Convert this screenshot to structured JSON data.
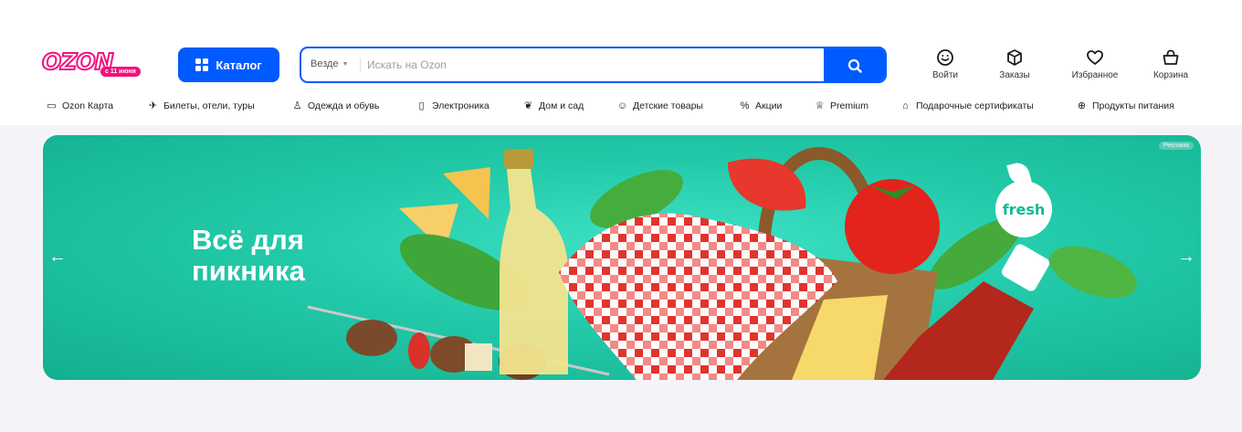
{
  "logo": {
    "text": "OZON",
    "badge": "с 11 июня"
  },
  "catalog_button": {
    "label": "Каталог"
  },
  "search": {
    "scope": "Везде",
    "placeholder": "Искать на Ozon"
  },
  "actions": [
    {
      "label": "Войти",
      "icon": "smile-icon"
    },
    {
      "label": "Заказы",
      "icon": "box-icon"
    },
    {
      "label": "Избранное",
      "icon": "heart-icon"
    },
    {
      "label": "Корзина",
      "icon": "basket-icon"
    }
  ],
  "nav": [
    {
      "label": "Ozon Карта",
      "icon": "card-icon"
    },
    {
      "label": "Билеты, отели, туры",
      "icon": "plane-icon"
    },
    {
      "label": "Одежда и обувь",
      "icon": "clothes-icon"
    },
    {
      "label": "Электроника",
      "icon": "phone-icon"
    },
    {
      "label": "Дом и сад",
      "icon": "plant-icon"
    },
    {
      "label": "Детские товары",
      "icon": "baby-icon"
    },
    {
      "label": "Акции",
      "icon": "percent-icon"
    },
    {
      "label": "Premium",
      "icon": "crown-icon"
    },
    {
      "label": "Подарочные сертификаты",
      "icon": "gift-icon"
    },
    {
      "label": "Продукты питания",
      "icon": "food-icon"
    }
  ],
  "banner": {
    "title_line1": "Всё для",
    "title_line2": "пикника",
    "ad_label": "Реклама",
    "brand_badge": "fresh",
    "background_color": "#22c9a8"
  },
  "colors": {
    "accent": "#005bff",
    "brand_pink": "#f1117e"
  }
}
